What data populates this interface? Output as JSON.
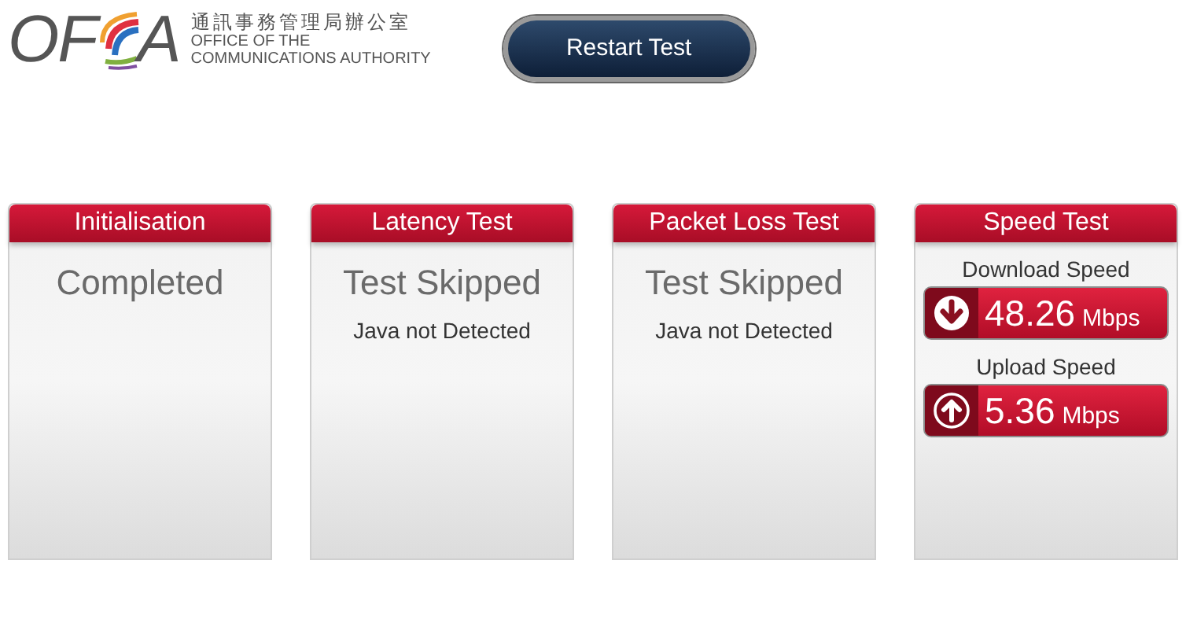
{
  "logo": {
    "mark_left": "OF",
    "mark_right": "A",
    "name_chinese": "通訊事務管理局辦公室",
    "name_english_line_1": "OFFICE OF THE",
    "name_english_line_2": "COMMUNICATIONS AUTHORITY"
  },
  "restart_button": "Restart Test",
  "panels": [
    {
      "kind": "status",
      "title": "Initialisation",
      "status": "Completed"
    },
    {
      "kind": "status",
      "title": "Latency Test",
      "status": "Test Skipped",
      "note": "Java not Detected"
    },
    {
      "kind": "status",
      "title": "Packet Loss Test",
      "status": "Test Skipped",
      "note": "Java not Detected"
    },
    {
      "kind": "speed",
      "title": "Speed Test",
      "results": [
        {
          "kind": "download",
          "label": "Download Speed",
          "value": "48.26",
          "unit": "Mbps"
        },
        {
          "kind": "upload",
          "label": "Upload Speed",
          "value": "5.36",
          "unit": "Mbps"
        }
      ]
    }
  ]
}
